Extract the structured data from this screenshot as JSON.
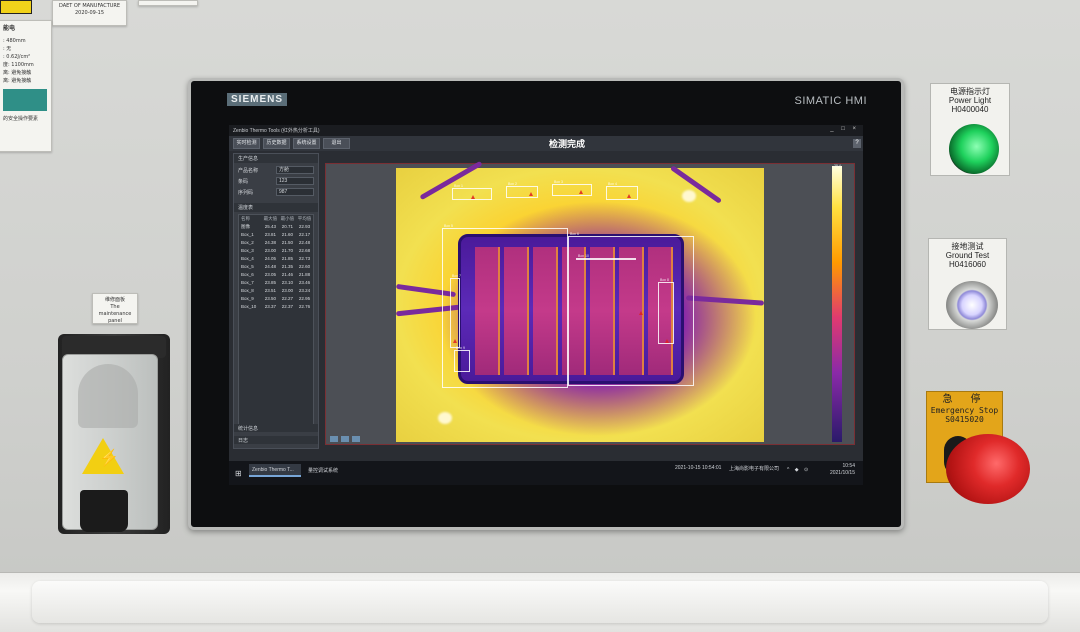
{
  "wall": {
    "mfg_label": "DAET OF MANUFACTURE",
    "mfg_date": "2020-09-15",
    "spec_title": "能电",
    "spec_lines": [
      ": 480mm",
      ": 无",
      ": 0.62J/cm²",
      "",
      "度: 1100mm",
      "离: 避免接触",
      "离: 避免接触"
    ],
    "spec_footer": "的安全操作要素",
    "maint_cn": "维修面板",
    "maint_en": "The maintenance panel"
  },
  "hmi": {
    "brand_left": "SIEMENS",
    "brand_right": "SIMATIC HMI",
    "window_title": "Zenbio Thermo Tools (红外热分析工具)",
    "toolbar": {
      "buttons": [
        "实时检测",
        "历史数据",
        "系统设置",
        "退出"
      ],
      "title": "检测完成",
      "help": "?"
    },
    "product_info": {
      "header": "生产信息",
      "rows": [
        {
          "k": "产品名称",
          "v": "方舱"
        },
        {
          "k": "条码",
          "v": "123"
        },
        {
          "k": "序列码",
          "v": "987"
        }
      ]
    },
    "temp_table": {
      "header": "温度表",
      "columns": [
        "名称",
        "最大值",
        "最小值",
        "平均值"
      ],
      "rows": [
        [
          "图像",
          "25.43",
          "20.71",
          "22.93"
        ],
        [
          "Box_1",
          "23.81",
          "21.60",
          "22.17"
        ],
        [
          "Box_2",
          "24.38",
          "21.50",
          "22.48"
        ],
        [
          "Box_3",
          "23.00",
          "21.70",
          "22.68"
        ],
        [
          "Box_4",
          "24.05",
          "21.85",
          "22.73"
        ],
        [
          "Box_5",
          "24.48",
          "21.35",
          "22.60"
        ],
        [
          "Box_6",
          "23.05",
          "21.46",
          "21.88"
        ],
        [
          "Box_7",
          "23.85",
          "23.10",
          "23.46"
        ],
        [
          "Box_8",
          "23.51",
          "23.00",
          "23.24"
        ],
        [
          "Box_9",
          "23.50",
          "22.27",
          "22.95"
        ],
        [
          "Box_10",
          "23.37",
          "22.37",
          "22.76"
        ]
      ]
    },
    "stats_header": "统计信息",
    "log_header": "日志",
    "roi_labels": [
      "Box 1",
      "Box 2",
      "Box 3",
      "Box 4",
      "Box 5",
      "Box 6",
      "Box 7",
      "Box 8",
      "Box 9",
      "Box 10"
    ],
    "scale_max": "25.4",
    "taskbar": {
      "start": "⊞",
      "app1": "Zenbio Thermo T...",
      "app2": "量控调试系统",
      "status": "2021-10-15 10:54:01",
      "company": "上海尚影电子有限公司",
      "tray": "^ ◆ ⊙",
      "time": "10:54",
      "date": "2021/10/15"
    }
  },
  "controls": {
    "power_cn": "电源指示灯",
    "power_en": "Power Light",
    "power_code": "H0400040",
    "ground_cn": "接地测试",
    "ground_en": "Ground Test",
    "ground_code": "H0416060",
    "estop_cn": "急 停",
    "estop_en": "Emergency Stop",
    "estop_code": "S0415020"
  },
  "colors": {
    "power_light": "#1ed15c",
    "estop": "#e02a2a",
    "estop_label": "#e3a51a"
  }
}
